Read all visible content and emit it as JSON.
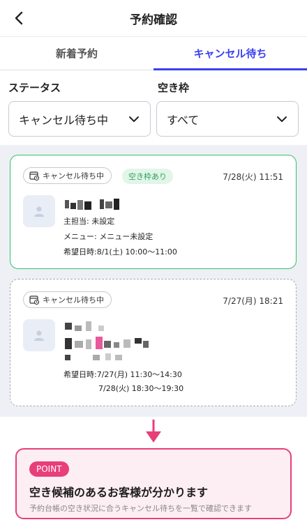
{
  "header": {
    "title": "予約確認"
  },
  "tabs": [
    {
      "label": "新着予約",
      "active": false
    },
    {
      "label": "キャンセル待ち",
      "active": true
    }
  ],
  "filters": {
    "status_label": "ステータス",
    "status_value": "キャンセル待ち中",
    "slot_label": "空き枠",
    "slot_value": "すべて"
  },
  "cards": [
    {
      "status": "キャンセル待ち中",
      "badge": "空き枠あり",
      "datetime": "7/28(火) 11:51",
      "lines": [
        "主担当: 未設定",
        "メニュー: メニュー未設定",
        "希望日時:8/1(土) 10:00〜11:00"
      ]
    },
    {
      "status": "キャンセル待ち中",
      "datetime": "7/27(月) 18:21",
      "lines": [
        "希望日時:7/27(月) 11:30〜14:30",
        "7/28(火) 18:30〜19:30"
      ]
    }
  ],
  "point": {
    "badge": "POINT",
    "title": "空き候補のあるお客様が分かります",
    "subtitle": "予約台帳の空き状況に合うキャンセル待ちを一覧で確認できます"
  },
  "colors": {
    "accent": "#3b3ff0",
    "available": "#38bf6c",
    "point": "#e83e7a"
  }
}
